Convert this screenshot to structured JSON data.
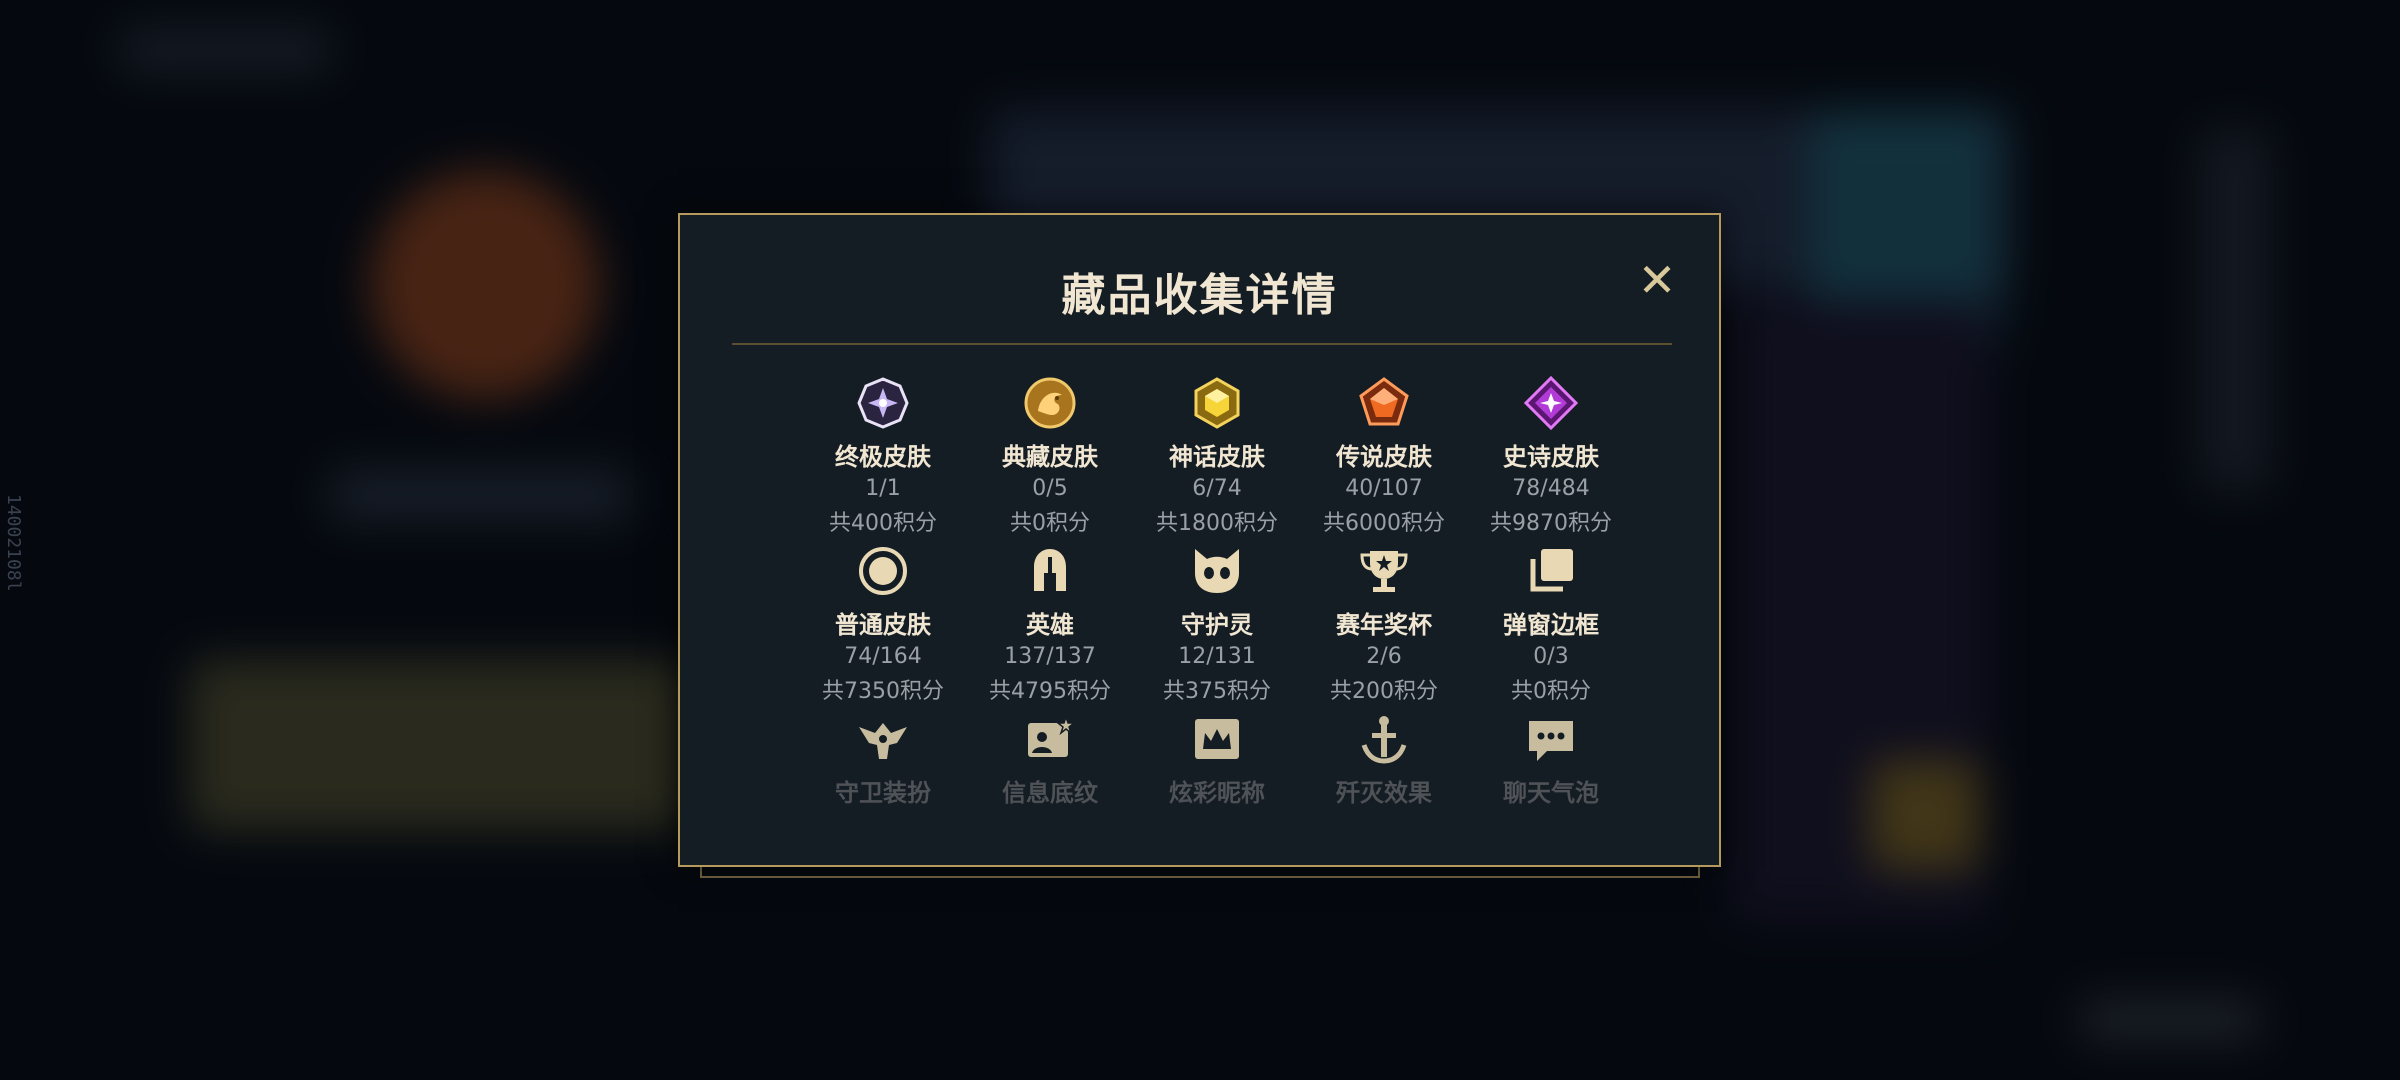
{
  "side_id": "14002108l",
  "modal": {
    "title": "藏品收集详情",
    "close_symbol": "✕"
  },
  "items": [
    {
      "name": "终极皮肤",
      "count": "1/1",
      "points": "共400积分",
      "icon": "ultimate-skin-icon"
    },
    {
      "name": "典藏皮肤",
      "count": "0/5",
      "points": "共0积分",
      "icon": "collector-skin-icon"
    },
    {
      "name": "神话皮肤",
      "count": "6/74",
      "points": "共1800积分",
      "icon": "mythic-skin-icon"
    },
    {
      "name": "传说皮肤",
      "count": "40/107",
      "points": "共6000积分",
      "icon": "legendary-skin-icon"
    },
    {
      "name": "史诗皮肤",
      "count": "78/484",
      "points": "共9870积分",
      "icon": "epic-skin-icon"
    },
    {
      "name": "普通皮肤",
      "count": "74/164",
      "points": "共7350积分",
      "icon": "standard-skin-icon"
    },
    {
      "name": "英雄",
      "count": "137/137",
      "points": "共4795积分",
      "icon": "champion-helmet-icon"
    },
    {
      "name": "守护灵",
      "count": "12/131",
      "points": "共375积分",
      "icon": "guardian-spirit-icon"
    },
    {
      "name": "赛年奖杯",
      "count": "2/6",
      "points": "共200积分",
      "icon": "season-trophy-icon"
    },
    {
      "name": "弹窗边框",
      "count": "0/3",
      "points": "共0积分",
      "icon": "popup-frame-icon"
    },
    {
      "name": "守卫装扮",
      "icon": "ward-skin-icon"
    },
    {
      "name": "信息底纹",
      "icon": "profile-banner-icon"
    },
    {
      "name": "炫彩昵称",
      "icon": "colorful-nickname-icon"
    },
    {
      "name": "歼灭效果",
      "icon": "elimination-effect-icon"
    },
    {
      "name": "聊天气泡",
      "icon": "chat-bubble-icon"
    }
  ],
  "colors": {
    "gold": "#c8aa6e",
    "border": "#b59a5c",
    "panel": "#141c24"
  }
}
